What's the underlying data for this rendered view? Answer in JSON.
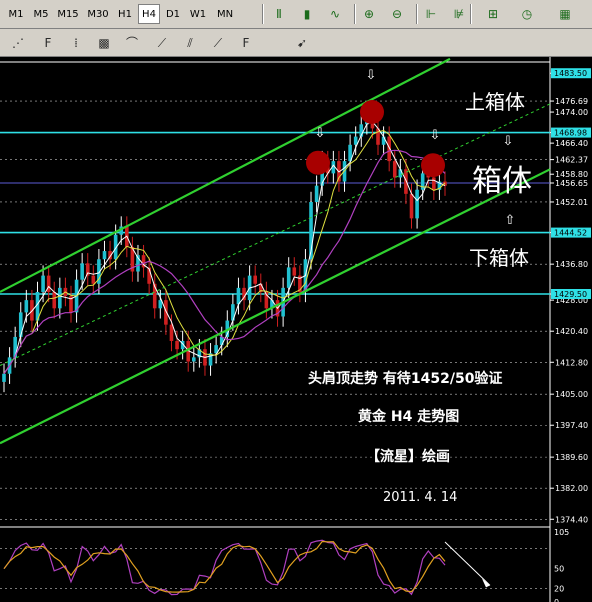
{
  "toolbar": {
    "timeframes": [
      "M1",
      "M5",
      "M15",
      "M30",
      "H1",
      "H4",
      "D1",
      "W1",
      "MN"
    ],
    "active_timeframe": "H4",
    "tools": [
      "bar-chart-icon",
      "candlestick-icon",
      "line-chart-icon",
      "zoom-in-icon",
      "zoom-out-icon",
      "chart-shift-icon",
      "autoscroll-icon",
      "add-indicator-icon",
      "period-clock-icon",
      "template-icon"
    ],
    "objects": [
      "fibo-retracement-icon",
      "fibo-expansion-icon",
      "fibo-time-icon",
      "fibo-arcs-icon",
      "fibo-fan-icon",
      "fibo-channel-icon",
      "gann-fan-icon",
      "gann-line-icon",
      "gann-grid-icon",
      "arrows-icon"
    ]
  },
  "chart_data": {
    "type": "candlestick",
    "symbol": "黄金",
    "timeframe": "H4",
    "y_axis_ticks": [
      1483.5,
      1476.69,
      1474.0,
      1466.4,
      1468.98,
      1462.37,
      1458.8,
      1456.65,
      1452.01,
      1444.52,
      1436.8,
      1429.5,
      1428.0,
      1420.4,
      1412.8,
      1405.0,
      1397.4,
      1389.6,
      1382.0,
      1374.4
    ],
    "ylim": [
      1373.0,
      1486.0
    ],
    "highlighted_levels": [
      1468.98,
      1456.65,
      1444.52,
      1429.5
    ],
    "price_tag_labels": [
      "1483.50",
      "1468.98",
      "1444.52",
      "1429.50"
    ],
    "zone_labels": {
      "upper": "上箱体",
      "middle": "箱体",
      "lower": "下箱体"
    },
    "annotations": {
      "line1": "头肩顶走势  有待1452/50验证",
      "line2": "黄金  H4  走势图",
      "line3": "【流星】绘画",
      "line4": "2011. 4. 14"
    },
    "closes": [
      1410,
      1414,
      1419,
      1425,
      1428,
      1423,
      1430,
      1434,
      1430,
      1426,
      1431,
      1429,
      1425,
      1433,
      1437,
      1434,
      1432,
      1438,
      1440,
      1438,
      1444,
      1446,
      1441,
      1435,
      1439,
      1436,
      1432,
      1426,
      1428,
      1422,
      1418,
      1416,
      1418,
      1413,
      1414,
      1416,
      1412,
      1415,
      1417,
      1419,
      1423,
      1427,
      1431,
      1428,
      1434,
      1432,
      1430,
      1426,
      1428,
      1424,
      1431,
      1436,
      1434,
      1430,
      1438,
      1452,
      1456,
      1462,
      1459,
      1462,
      1457,
      1462,
      1466,
      1468,
      1471,
      1474,
      1470,
      1466,
      1468,
      1462,
      1458,
      1460,
      1454,
      1448,
      1455,
      1459,
      1458,
      1455,
      1457,
      1456
    ],
    "indicator": {
      "name": "Stochastic",
      "ticks": [
        105,
        50,
        20,
        0
      ],
      "levels": [
        80,
        20
      ]
    }
  }
}
